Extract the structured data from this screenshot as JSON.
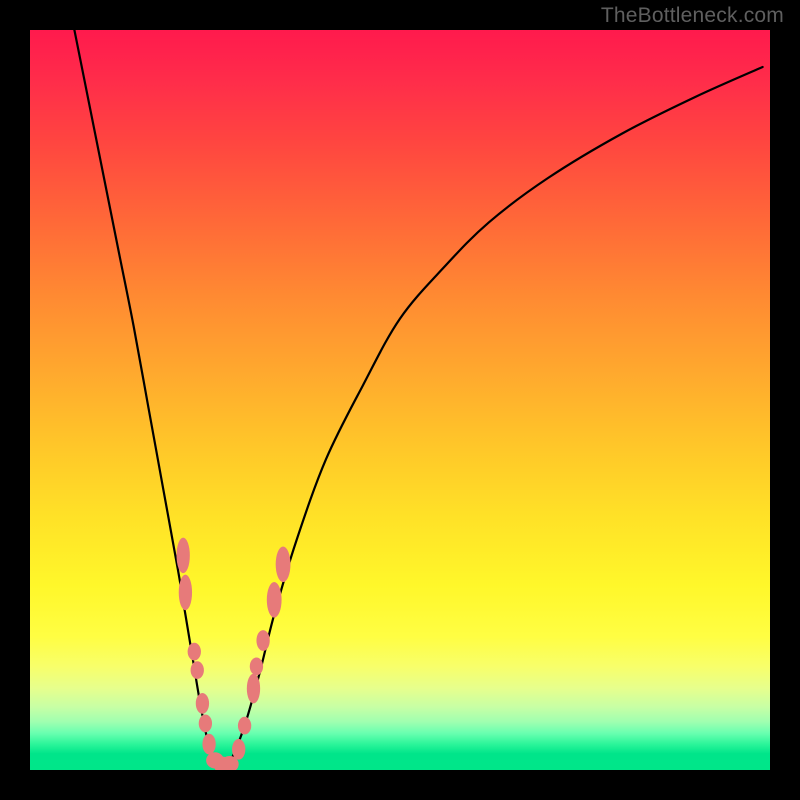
{
  "watermark": {
    "text": "TheBottleneck.com"
  },
  "colors": {
    "background": "#000000",
    "curve_stroke": "#000000",
    "marker_fill": "#e77a7a",
    "gradient_top": "#ff1a4d",
    "gradient_bottom": "#00e689"
  },
  "chart_data": {
    "type": "line",
    "title": "",
    "xlabel": "",
    "ylabel": "",
    "xlim": [
      0,
      100
    ],
    "ylim": [
      0,
      100
    ],
    "grid": false,
    "series": [
      {
        "name": "bottleneck-curve",
        "x": [
          6,
          8,
          10,
          12,
          14,
          16,
          18,
          20,
          21,
          22,
          23,
          24,
          25,
          26,
          27,
          29,
          31,
          33,
          36,
          40,
          45,
          50,
          56,
          62,
          70,
          80,
          90,
          99
        ],
        "y": [
          100,
          90,
          80,
          70,
          60,
          49,
          38,
          27,
          21,
          15,
          9,
          4,
          1,
          0,
          1,
          6,
          13,
          21,
          31,
          42,
          52,
          61,
          68,
          74,
          80,
          86,
          91,
          95
        ]
      }
    ],
    "markers": [
      {
        "x": 20.7,
        "y": 29.0,
        "rx": 0.9,
        "ry": 2.4
      },
      {
        "x": 21.0,
        "y": 24.0,
        "rx": 0.9,
        "ry": 2.4
      },
      {
        "x": 22.2,
        "y": 16.0,
        "rx": 0.9,
        "ry": 1.2
      },
      {
        "x": 22.6,
        "y": 13.5,
        "rx": 0.9,
        "ry": 1.2
      },
      {
        "x": 23.3,
        "y": 9.0,
        "rx": 0.9,
        "ry": 1.4
      },
      {
        "x": 23.7,
        "y": 6.3,
        "rx": 0.9,
        "ry": 1.2
      },
      {
        "x": 24.2,
        "y": 3.5,
        "rx": 0.9,
        "ry": 1.4
      },
      {
        "x": 25.0,
        "y": 1.3,
        "rx": 1.2,
        "ry": 1.1
      },
      {
        "x": 26.0,
        "y": 0.7,
        "rx": 1.2,
        "ry": 1.1
      },
      {
        "x": 27.0,
        "y": 0.8,
        "rx": 1.2,
        "ry": 1.1
      },
      {
        "x": 28.2,
        "y": 2.8,
        "rx": 0.9,
        "ry": 1.4
      },
      {
        "x": 29.0,
        "y": 6.0,
        "rx": 0.9,
        "ry": 1.2
      },
      {
        "x": 30.2,
        "y": 11.0,
        "rx": 0.9,
        "ry": 2.0
      },
      {
        "x": 30.6,
        "y": 14.0,
        "rx": 0.9,
        "ry": 1.2
      },
      {
        "x": 31.5,
        "y": 17.5,
        "rx": 0.9,
        "ry": 1.4
      },
      {
        "x": 33.0,
        "y": 23.0,
        "rx": 1.0,
        "ry": 2.4
      },
      {
        "x": 34.2,
        "y": 27.8,
        "rx": 1.0,
        "ry": 2.4
      }
    ]
  }
}
